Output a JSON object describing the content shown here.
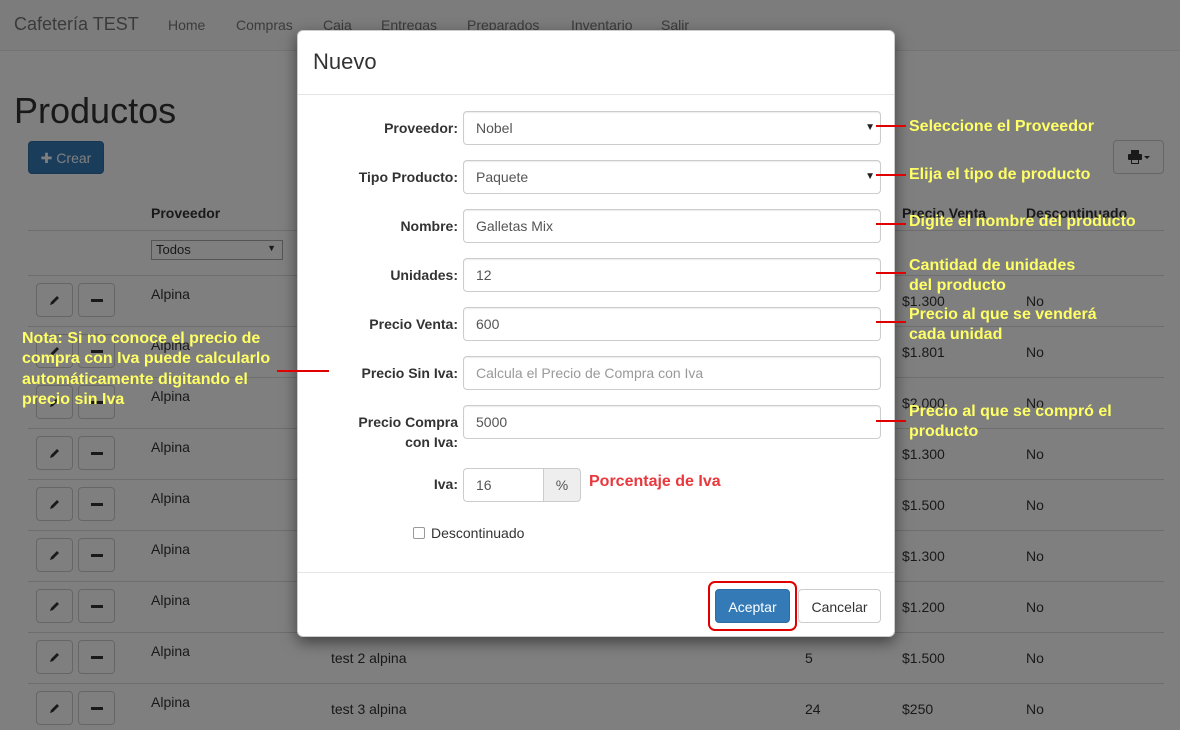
{
  "navbar": {
    "brand": "Cafetería TEST",
    "links": [
      "Home",
      "Compras",
      "Caja",
      "Entregas",
      "Preparados",
      "Inventario",
      "Salir"
    ]
  },
  "page": {
    "title": "Productos",
    "create_button": "Crear",
    "create_icon": "plus-icon",
    "print_icon": "print-icon"
  },
  "table": {
    "headers": [
      "Proveedor",
      "Precio Venta",
      "Descontinuado"
    ],
    "filter_value": "Todos",
    "rows": [
      {
        "proveedor": "Alpina",
        "nombre": "",
        "unidades": "",
        "precio": "$1.300",
        "descontinuado": "No"
      },
      {
        "proveedor": "Alpina",
        "nombre": "",
        "unidades": "",
        "precio": "$1.801",
        "descontinuado": "No"
      },
      {
        "proveedor": "Alpina",
        "nombre": "",
        "unidades": "",
        "precio": "$2.000",
        "descontinuado": "No"
      },
      {
        "proveedor": "Alpina",
        "nombre": "",
        "unidades": "",
        "precio": "$1.300",
        "descontinuado": "No"
      },
      {
        "proveedor": "Alpina",
        "nombre": "",
        "unidades": "",
        "precio": "$1.500",
        "descontinuado": "No"
      },
      {
        "proveedor": "Alpina",
        "nombre": "",
        "unidades": "",
        "precio": "$1.300",
        "descontinuado": "No"
      },
      {
        "proveedor": "Alpina",
        "nombre": "",
        "unidades": "",
        "precio": "$1.200",
        "descontinuado": "No"
      },
      {
        "proveedor": "Alpina",
        "nombre": "test 2 alpina",
        "unidades": "5",
        "precio": "$1.500",
        "descontinuado": "No"
      },
      {
        "proveedor": "Alpina",
        "nombre": "test 3 alpina",
        "unidades": "24",
        "precio": "$250",
        "descontinuado": "No"
      }
    ]
  },
  "modal": {
    "title": "Nuevo",
    "fields": {
      "proveedor": {
        "label": "Proveedor:",
        "value": "Nobel"
      },
      "tipo": {
        "label": "Tipo Producto:",
        "value": "Paquete"
      },
      "nombre": {
        "label": "Nombre:",
        "value": "Galletas Mix"
      },
      "unidades": {
        "label": "Unidades:",
        "value": "12"
      },
      "precio_venta": {
        "label": "Precio Venta:",
        "value": "600"
      },
      "precio_sin_iva": {
        "label": "Precio Sin Iva:",
        "placeholder": "Calcula el Precio de Compra con Iva"
      },
      "precio_compra_1": "Precio Compra",
      "precio_compra_2": "con Iva:",
      "precio_compra_value": "5000",
      "iva": {
        "label": "Iva:",
        "value": "16",
        "addon": "%"
      }
    },
    "checkbox_label": "Descontinuado",
    "ok_label": "Aceptar",
    "cancel_label": "Cancelar"
  },
  "annotations": {
    "proveedor": "Seleccione el Proveedor",
    "tipo": "Elija el tipo de producto",
    "nombre": "Digite el nombre del producto",
    "unidades_1": "Cantidad de unidades",
    "unidades_2": "del producto",
    "precio_venta_1": "Precio al que se venderá",
    "precio_venta_2": "cada unidad",
    "precio_compra_1": "Precio al que se compró el",
    "precio_compra_2": "producto",
    "iva": "Porcentaje de Iva",
    "nota_1": "Nota: Si no conoce el precio de",
    "nota_2": "compra con Iva puede calcularlo",
    "nota_3": "automáticamente digitando el",
    "nota_4": "precio sin Iva"
  },
  "colors": {
    "primary": "#337ab7",
    "annotation_text": "#ffff66",
    "annotation_line": "#e00000",
    "iva_note": "#e8383d"
  }
}
